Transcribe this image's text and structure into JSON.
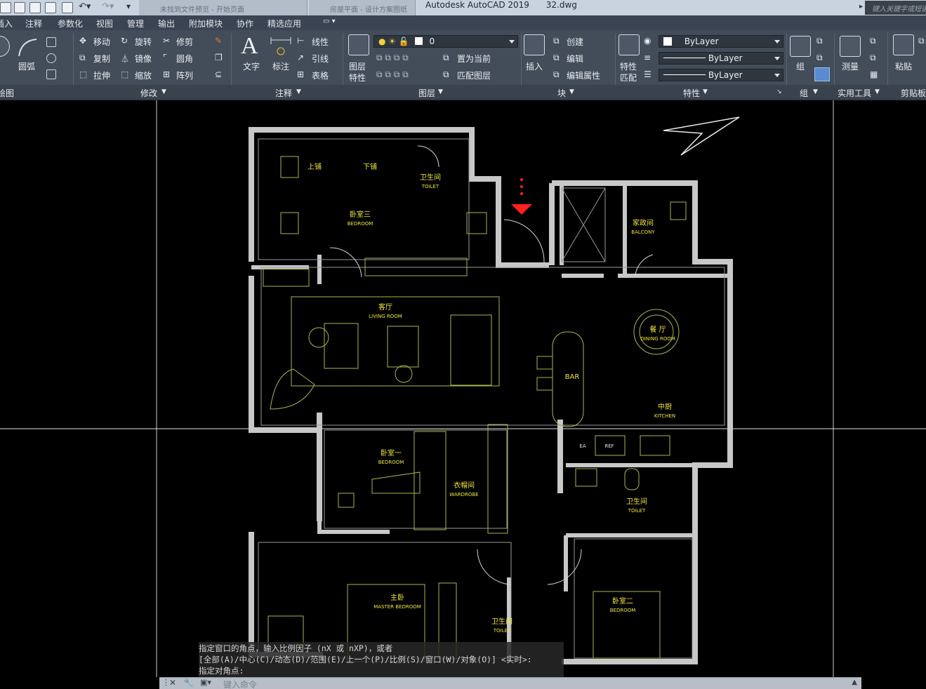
{
  "titlebar": {
    "app_title": "Autodesk AutoCAD 2019",
    "file_name": "32.dwg",
    "search_placeholder": "键入关键字或短语",
    "tabs": [
      "未找到文件预览 - 开始页面",
      "房屋平面 - 设计方案图纸"
    ]
  },
  "menu": {
    "items": [
      "插入",
      "注释",
      "参数化",
      "视图",
      "管理",
      "输出",
      "附加模块",
      "协作",
      "精选应用"
    ]
  },
  "ribbon": {
    "draw": {
      "arc_label": "圆弧",
      "panel_label": "绘图"
    },
    "modify": {
      "move": "移动",
      "rotate": "旋转",
      "trim": "修剪",
      "copy": "复制",
      "mirror": "镜像",
      "fillet": "圆角",
      "stretch": "拉伸",
      "scale": "缩放",
      "array": "阵列",
      "panel_label": "修改"
    },
    "annotation": {
      "text": "文字",
      "dimension": "标注",
      "linear": "线性",
      "leader": "引线",
      "table": "表格",
      "panel_label": "注释"
    },
    "layers": {
      "properties": "图层特性",
      "layer_properties_l1": "图层",
      "layer_properties_l2": "特性",
      "current_layer": "0",
      "set_current": "置为当前",
      "match_layer": "匹配图层",
      "panel_label": "图层"
    },
    "block": {
      "insert": "插入",
      "create": "创建",
      "edit": "编辑",
      "edit_attributes": "编辑属性",
      "panel_label": "块"
    },
    "properties": {
      "match_l1": "特性",
      "match_l2": "匹配",
      "color": "ByLayer",
      "linetype": "ByLayer",
      "lineweight": "ByLayer",
      "panel_label": "特性"
    },
    "groups": {
      "group": "组",
      "panel_label": "组"
    },
    "utilities": {
      "measure": "测量",
      "panel_label": "实用工具"
    },
    "clipboard": {
      "paste": "粘贴",
      "panel_label": "剪贴板"
    }
  },
  "floorplan": {
    "rooms": [
      {
        "cn": "上铺",
        "en": ""
      },
      {
        "cn": "下铺",
        "en": ""
      },
      {
        "cn": "卧室三",
        "en": "BEDROOM"
      },
      {
        "cn": "卫生间",
        "en": "TOILET"
      },
      {
        "cn": "家政间",
        "en": "BALCONY"
      },
      {
        "cn": "客厅",
        "en": "LIVING ROOM"
      },
      {
        "cn": "餐 厅",
        "en": "DINING ROOM"
      },
      {
        "cn": "BAR",
        "en": ""
      },
      {
        "cn": "中厨",
        "en": "KITCHEN"
      },
      {
        "cn": "卧室一",
        "en": "BEDROOM"
      },
      {
        "cn": "衣帽间",
        "en": "WARDROBE"
      },
      {
        "cn": "卫生间",
        "en": "TOILET"
      },
      {
        "cn": "主卧",
        "en": "MASTER BEDROOM"
      },
      {
        "cn": "卫生间",
        "en": "TOILET"
      },
      {
        "cn": "卧室二",
        "en": "BEDROOM"
      }
    ],
    "fixtures": [
      "REF",
      "EA"
    ]
  },
  "command": {
    "line1": "指定窗口的角点，输入比例因子 (nX 或 nXP)，或者",
    "line2": "[全部(A)/中心(C)/动态(D)/范围(E)/上一个(P)/比例(S)/窗口(W)/对象(O)] <实时>:",
    "line3": "指定对角点:",
    "input_placeholder": "键入命令"
  },
  "colors": {
    "wall": "#c8c8c8",
    "furniture": "#a8b84a",
    "room_label": "#f0e63c",
    "crosshair": "#ffffff",
    "entrance_marker": "#ff2020"
  }
}
